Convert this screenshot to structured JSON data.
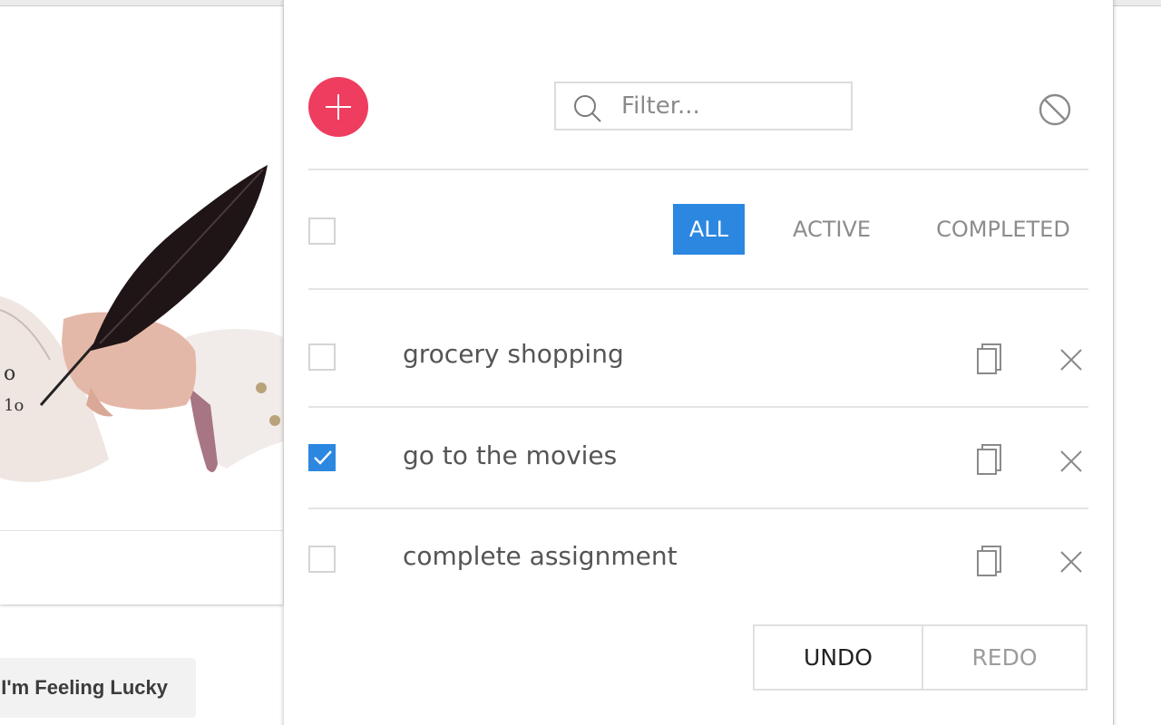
{
  "background": {
    "lucky_button_label": "I'm Feeling Lucky",
    "doodle_description": "quill-pen-doodle"
  },
  "toolbar": {
    "add_icon": "plus-icon",
    "filter_placeholder": "Filter...",
    "search_icon": "search-icon",
    "clear_icon": "ban-icon"
  },
  "tabs": [
    {
      "label": "ALL",
      "active": true
    },
    {
      "label": "ACTIVE",
      "active": false
    },
    {
      "label": "COMPLETED",
      "active": false
    }
  ],
  "todos": [
    {
      "text": "grocery shopping",
      "completed": false
    },
    {
      "text": "go to the movies",
      "completed": true
    },
    {
      "text": "complete assignment",
      "completed": false
    }
  ],
  "history": {
    "undo_label": "UNDO",
    "redo_label": "REDO"
  },
  "colors": {
    "accent_red": "#ee3d5f",
    "accent_blue": "#2c87e0"
  }
}
